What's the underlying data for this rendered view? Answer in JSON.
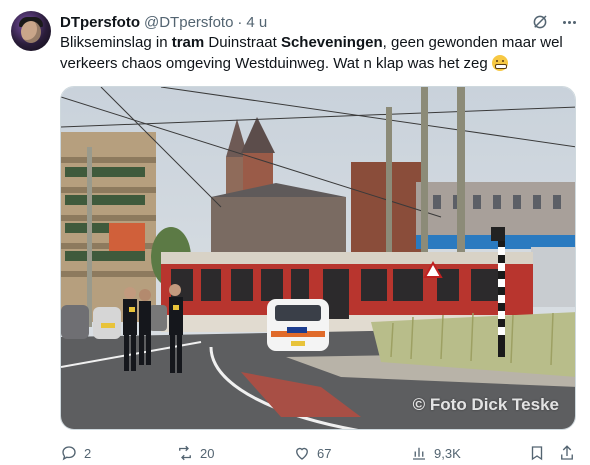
{
  "tweet": {
    "author_name": "DTpersfoto",
    "author_handle": "@DTpersfoto",
    "separator": "·",
    "time": "4 u",
    "text_parts": {
      "p1": "Blikseminslag in ",
      "p2": "tram",
      "p3": " Duinstraat ",
      "p4": "Scheveningen",
      "p5": ", geen gewonden maar wel verkeers chaos omgeving Westduinweg. Wat n klap was het zeg "
    },
    "emoji": "grimacing-face",
    "media": {
      "watermark": "© Foto Dick Teske"
    }
  },
  "actions": {
    "replies": "2",
    "reposts": "20",
    "likes": "67",
    "views": "9,3K"
  },
  "icons": [
    "grok-icon",
    "more-icon",
    "reply-icon",
    "repost-icon",
    "like-icon",
    "views-icon",
    "bookmark-icon",
    "share-icon"
  ],
  "colors": {
    "text": "#0f1419",
    "secondary": "#536471",
    "border": "#cfd9de"
  }
}
